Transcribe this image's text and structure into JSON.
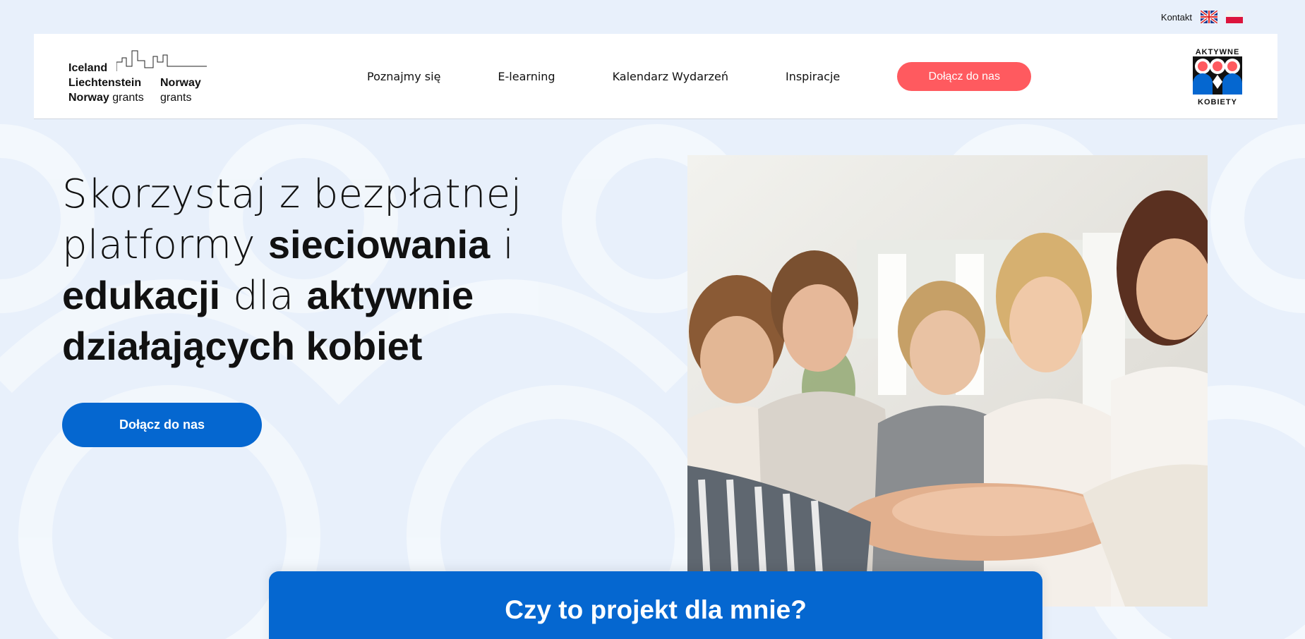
{
  "topbar": {
    "contact_label": "Kontakt",
    "languages": [
      "en-flag-icon",
      "pl-flag-icon"
    ]
  },
  "header": {
    "grants_logo": {
      "line1": "Iceland",
      "line2": "Liechtenstein",
      "line3_bold": "Norway",
      "line3_rest": "grants",
      "right_bold": "Norway",
      "right_rest": "grants"
    },
    "nav": [
      {
        "label": "Poznajmy się"
      },
      {
        "label": "E-learning"
      },
      {
        "label": "Kalendarz Wydarzeń"
      },
      {
        "label": "Inspiracje"
      }
    ],
    "cta_label": "Dołącz do nas",
    "ak_logo": {
      "top": "AKTYWNE",
      "bottom": "KOBIETY"
    }
  },
  "hero": {
    "title_parts": {
      "p1": "Skorzystaj z bezpłatnej platformy ",
      "b1": "sieciowania",
      "p2": " i ",
      "b2": "edukacji",
      "p3": " dla ",
      "b3": "aktywnie działających kobiet"
    },
    "cta_label": "Dołącz do nas",
    "photo": "women-stacking-hands-photo"
  },
  "section_card": {
    "title": "Czy to projekt dla mnie?"
  },
  "colors": {
    "background": "#e8f0fb",
    "primary_blue": "#0567d0",
    "accent_coral": "#ff5a5f",
    "white": "#ffffff"
  }
}
